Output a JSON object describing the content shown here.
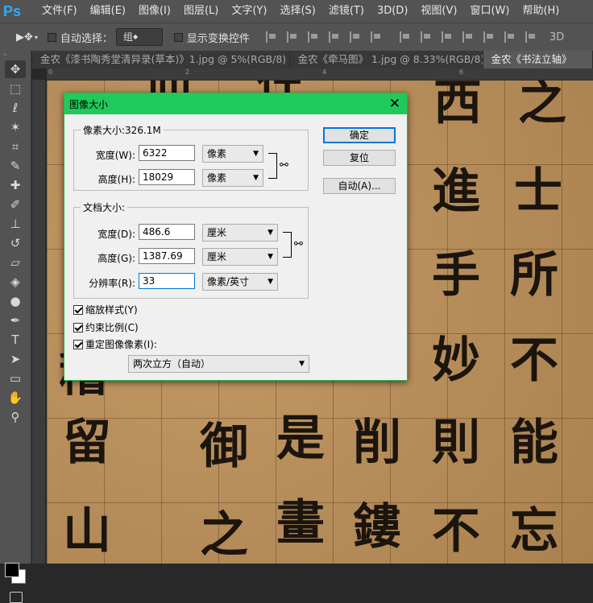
{
  "app": {
    "logo": "Ps"
  },
  "menu": [
    "文件(F)",
    "编辑(E)",
    "图像(I)",
    "图层(L)",
    "文字(Y)",
    "选择(S)",
    "滤镜(T)",
    "3D(D)",
    "视图(V)",
    "窗口(W)",
    "帮助(H)"
  ],
  "options": {
    "auto_select_label": "自动选择：",
    "auto_select_value": "组",
    "show_transform_label": "显示变换控件",
    "mode_3d": "3D"
  },
  "tabs": [
    {
      "label": "金农《漆书陶秀堂清异录(草本)》1.jpg @ 5%(RGB/8)",
      "active": false,
      "close": "×"
    },
    {
      "label": "金农《牵马图》 1.jpg @ 8.33%(RGB/8)",
      "active": false,
      "close": "×"
    },
    {
      "label": "金农《书法立轴》",
      "active": true,
      "close": ""
    }
  ],
  "ruler": {
    "labels": [
      "0",
      "2",
      "4",
      "6"
    ]
  },
  "canvas": {
    "glyphs": [
      "仙",
      "往",
      "西",
      "之",
      "進",
      "士",
      "手",
      "所",
      "妙",
      "不",
      "稽",
      "留",
      "御",
      "是",
      "削",
      "則",
      "能",
      "山",
      "之",
      "畫",
      "鏤",
      "不",
      "忘"
    ]
  },
  "dialog": {
    "title": "图像大小",
    "close": "✕",
    "pixel_dims": {
      "legend": "像素大小:326.1M",
      "width_label": "宽度(W):",
      "width_value": "6322",
      "width_unit": "像素",
      "height_label": "高度(H):",
      "height_value": "18029",
      "height_unit": "像素"
    },
    "doc_size": {
      "legend": "文档大小:",
      "width_label": "宽度(D):",
      "width_value": "486.6",
      "width_unit": "厘米",
      "height_label": "高度(G):",
      "height_value": "1387.69",
      "height_unit": "厘米",
      "res_label": "分辨率(R):",
      "res_value": "33",
      "res_unit": "像素/英寸"
    },
    "buttons": {
      "ok": "确定",
      "reset": "复位",
      "auto": "自动(A)..."
    },
    "checks": {
      "scale_styles": "缩放样式(Y)",
      "constrain": "约束比例(C)",
      "resample": "重定图像像素(I):"
    },
    "resample_method": "两次立方（自动）"
  }
}
